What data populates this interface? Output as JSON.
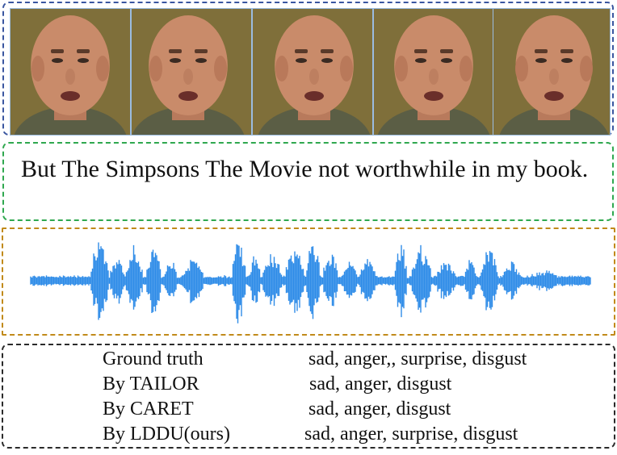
{
  "video": {
    "frame_count": 5,
    "colors": {
      "background": "#7f6f3a",
      "skin": "#c98b6a",
      "shirt": "#5b5e45"
    }
  },
  "transcript": {
    "text": "But The Simpsons The Movie not worthwhile in my book."
  },
  "audio": {
    "color": "#2f8ce8"
  },
  "labels": {
    "rows": [
      {
        "method": "Ground truth",
        "emotions": "sad, anger,, surprise, disgust"
      },
      {
        "method": "By TAILOR",
        "emotions": "sad, anger, disgust"
      },
      {
        "method": "By CARET",
        "emotions": "sad, anger, disgust"
      },
      {
        "method": "By LDDU(ours)",
        "emotions": "sad, anger, surprise, disgust"
      }
    ]
  }
}
